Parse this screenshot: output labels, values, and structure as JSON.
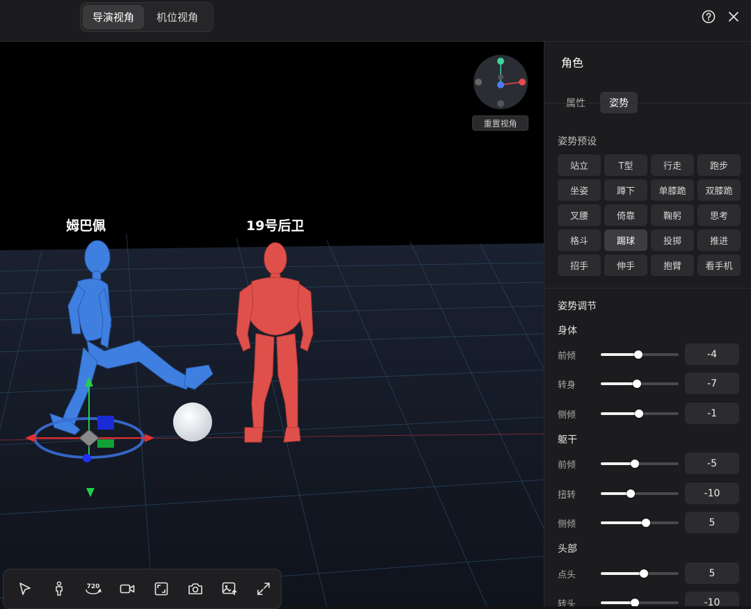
{
  "topbar": {
    "tabs": [
      {
        "label": "导演视角",
        "active": true
      },
      {
        "label": "机位视角",
        "active": false
      }
    ],
    "help_icon": "help-circle-icon",
    "close_icon": "close-icon"
  },
  "viewport": {
    "characters": [
      {
        "name": "姆巴佩",
        "color": "#3f7fe0"
      },
      {
        "name": "19号后卫",
        "color": "#e0504a"
      }
    ],
    "reset_view_label": "重置视角",
    "compass_colors": {
      "x": "#e74c4c",
      "y": "#3fd69a",
      "z": "#4a7dff"
    }
  },
  "toolbar": {
    "tools": [
      "select-arrow-icon",
      "character-icon",
      "rotate-720-icon",
      "video-camera-icon",
      "frame-icon",
      "photo-camera-icon",
      "image-upload-icon",
      "expand-icon"
    ],
    "rotate_label": "720"
  },
  "panel": {
    "title": "角色",
    "tabs": [
      {
        "label": "属性",
        "active": false
      },
      {
        "label": "姿势",
        "active": true
      }
    ],
    "presets_label": "姿势预设",
    "presets": [
      {
        "label": "站立",
        "active": false
      },
      {
        "label": "T型",
        "active": false
      },
      {
        "label": "行走",
        "active": false
      },
      {
        "label": "跑步",
        "active": false
      },
      {
        "label": "坐姿",
        "active": false
      },
      {
        "label": "蹲下",
        "active": false
      },
      {
        "label": "单膝跪",
        "active": false
      },
      {
        "label": "双膝跪",
        "active": false
      },
      {
        "label": "叉腰",
        "active": false
      },
      {
        "label": "倚靠",
        "active": false
      },
      {
        "label": "鞠躬",
        "active": false
      },
      {
        "label": "思考",
        "active": false
      },
      {
        "label": "格斗",
        "active": false
      },
      {
        "label": "踢球",
        "active": true
      },
      {
        "label": "投掷",
        "active": false
      },
      {
        "label": "推进",
        "active": false
      },
      {
        "label": "招手",
        "active": false
      },
      {
        "label": "伸手",
        "active": false
      },
      {
        "label": "抱臂",
        "active": false
      },
      {
        "label": "看手机",
        "active": false
      }
    ],
    "adjust_label": "姿势调节",
    "groups": [
      {
        "label": "身体",
        "sliders": [
          {
            "label": "前倾",
            "value": "-4",
            "fraction": 0.48
          },
          {
            "label": "转身",
            "value": "-7",
            "fraction": 0.46
          },
          {
            "label": "侧倾",
            "value": "-1",
            "fraction": 0.49
          }
        ]
      },
      {
        "label": "躯干",
        "sliders": [
          {
            "label": "前倾",
            "value": "-5",
            "fraction": 0.44
          },
          {
            "label": "扭转",
            "value": "-10",
            "fraction": 0.38
          },
          {
            "label": "侧倾",
            "value": "5",
            "fraction": 0.58
          }
        ]
      },
      {
        "label": "头部",
        "sliders": [
          {
            "label": "点头",
            "value": "5",
            "fraction": 0.55
          },
          {
            "label": "转头",
            "value": "-10",
            "fraction": 0.44
          }
        ]
      }
    ]
  }
}
